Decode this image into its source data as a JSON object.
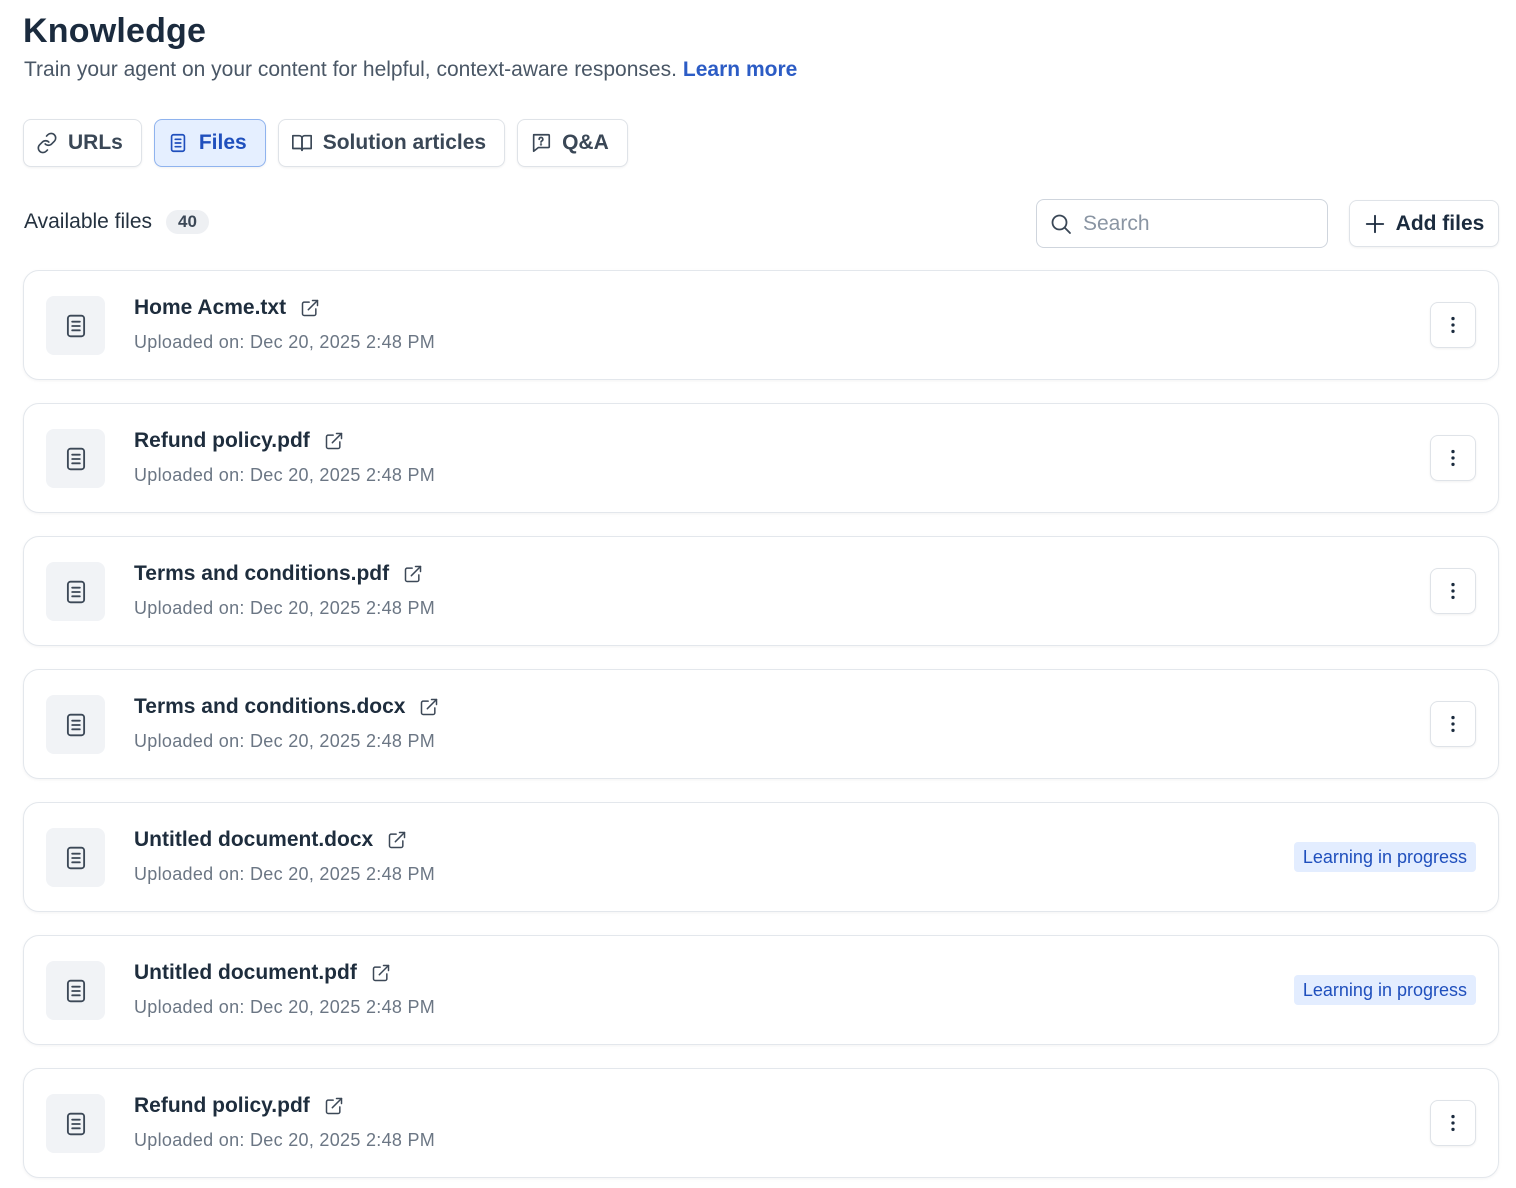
{
  "header": {
    "title": "Knowledge",
    "subtitle": "Train your agent on your content for helpful, context-aware responses.",
    "learn_more": "Learn more"
  },
  "tabs": [
    {
      "label": "URLs",
      "icon": "link-icon",
      "active": false
    },
    {
      "label": "Files",
      "icon": "document-icon",
      "active": true
    },
    {
      "label": "Solution articles",
      "icon": "book-icon",
      "active": false
    },
    {
      "label": "Q&A",
      "icon": "question-chat-icon",
      "active": false
    }
  ],
  "files_section": {
    "label": "Available files",
    "count": "40",
    "search_placeholder": "Search",
    "add_button": "Add files"
  },
  "files": [
    {
      "name": "Home Acme.txt",
      "uploaded": "Uploaded on: Dec 20, 2025 2:48 PM",
      "status": ""
    },
    {
      "name": "Refund policy.pdf",
      "uploaded": "Uploaded on: Dec 20, 2025 2:48 PM",
      "status": ""
    },
    {
      "name": "Terms and conditions.pdf",
      "uploaded": "Uploaded on: Dec 20, 2025 2:48 PM",
      "status": ""
    },
    {
      "name": "Terms and conditions.docx",
      "uploaded": "Uploaded on: Dec 20, 2025 2:48 PM",
      "status": ""
    },
    {
      "name": "Untitled document.docx",
      "uploaded": "Uploaded on: Dec 20, 2025 2:48 PM",
      "status": "Learning in progress"
    },
    {
      "name": "Untitled document.pdf",
      "uploaded": "Uploaded on: Dec 20, 2025 2:48 PM",
      "status": "Learning in progress"
    },
    {
      "name": "Refund policy.pdf",
      "uploaded": "Uploaded on: Dec 20, 2025 2:48 PM",
      "status": ""
    }
  ],
  "colors": {
    "accent": "#2c5cc5",
    "active_tab_bg": "#e5efff",
    "status_bg": "#e3edff",
    "title": "#1b2b3e"
  }
}
